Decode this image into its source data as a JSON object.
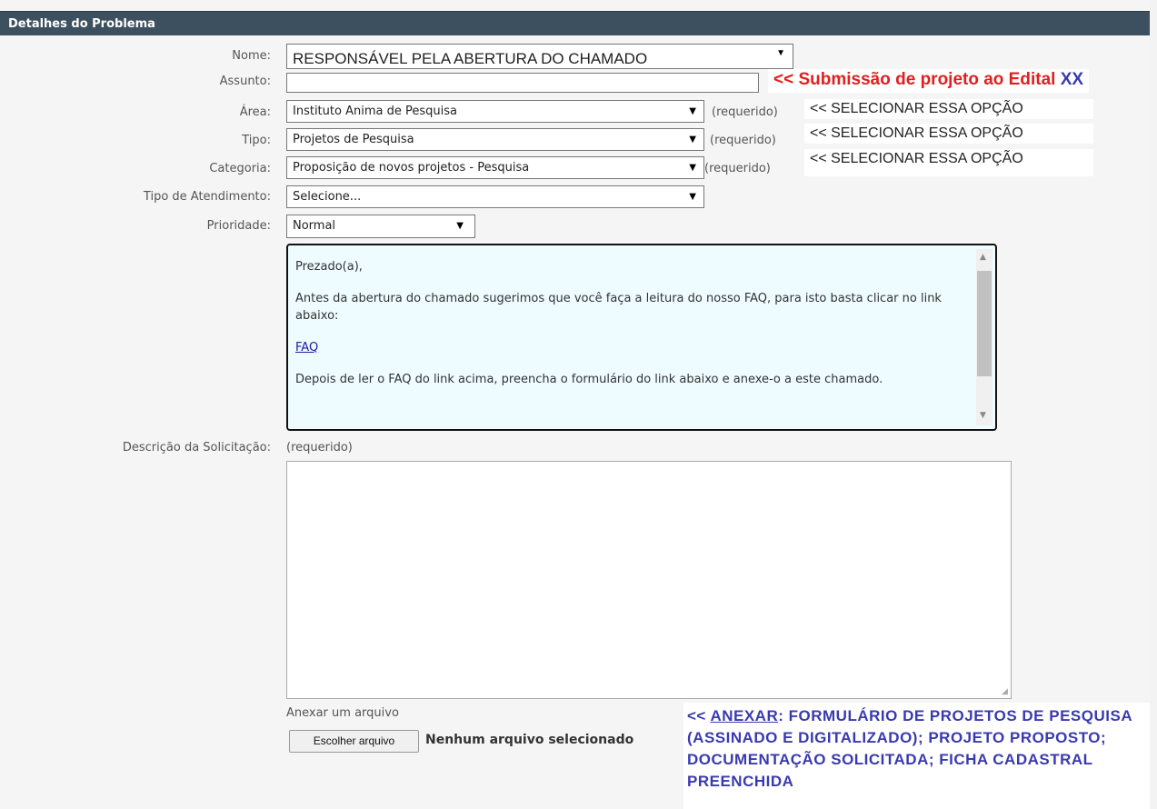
{
  "header": {
    "title": "Detalhes do Problema"
  },
  "form": {
    "nome": {
      "label": "Nome:",
      "value": "RESPONSÁVEL PELA ABERTURA DO CHAMADO"
    },
    "assunto": {
      "label": "Assunto:",
      "value": ""
    },
    "area": {
      "label": "Área:",
      "value": "Instituto Anima de Pesquisa",
      "required": "(requerido)"
    },
    "tipo": {
      "label": "Tipo:",
      "value": "Projetos de Pesquisa",
      "required": "(requerido)"
    },
    "categoria": {
      "label": "Categoria:",
      "value": "Proposição de novos projetos - Pesquisa",
      "required": "(requerido)"
    },
    "tipo_atendimento": {
      "label": "Tipo de Atendimento:",
      "value": "Selecione..."
    },
    "prioridade": {
      "label": "Prioridade:",
      "value": "Normal"
    },
    "descricao": {
      "label": "Descrição da Solicitação:",
      "required": "(requerido)",
      "value": ""
    },
    "anexo": {
      "label": "Anexar um arquivo",
      "button": "Escolher arquivo",
      "status": "Nenhum arquivo selecionado"
    }
  },
  "faq": {
    "greeting": "Prezado(a),",
    "intro": "Antes da abertura do chamado sugerimos que você faça a leitura do nosso FAQ, para isto basta clicar no link abaixo:",
    "link": "FAQ",
    "after": "Depois de ler o FAQ do link acima, preencha o formulário do link abaixo e anexe-o a este chamado."
  },
  "annotations": {
    "assunto_prefix": "<< Submissão de projeto ao Edital ",
    "assunto_suffix": "XX",
    "selecionar": "<< SELECIONAR ESSA OPÇÃO",
    "anexar_prefix": "<< ",
    "anexar_link": "ANEXAR",
    "anexar_text": ": FORMULÁRIO DE PROJETOS DE PESQUISA (ASSINADO E DIGITALIZADO); PROJETO PROPOSTO; DOCUMENTAÇÃO SOLICITADA; FICHA CADASTRAL PREENCHIDA",
    "colors": {
      "red": "#e02020",
      "blue": "#3a3ab0"
    }
  }
}
